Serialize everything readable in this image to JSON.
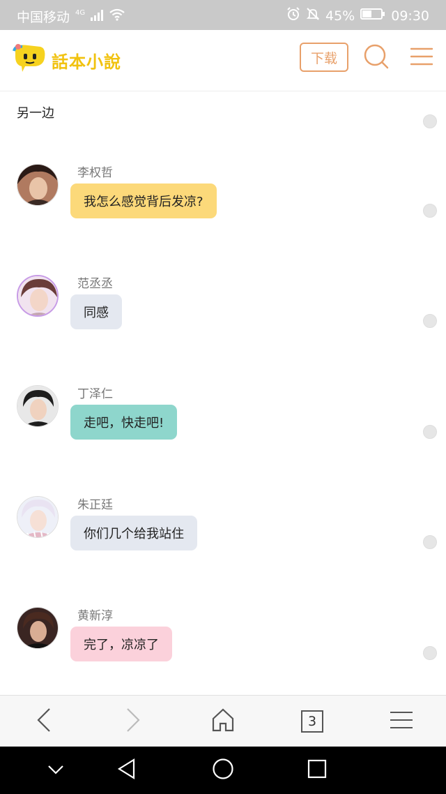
{
  "status_bar": {
    "carrier": "中国移动",
    "network": "4G",
    "battery": "45%",
    "time": "09:30"
  },
  "header": {
    "logo_text": "話本小說",
    "download_label": "下载",
    "accent_color": "#e8a06a"
  },
  "chapter": {
    "title": "另一边"
  },
  "messages": [
    {
      "name": "李权哲",
      "text": "我怎么感觉背后发凉?",
      "bubble_color": "#fcd97a"
    },
    {
      "name": "范丞丞",
      "text": "同感",
      "bubble_color": "#e4e8f0"
    },
    {
      "name": "丁泽仁",
      "text": "走吧，快走吧!",
      "bubble_color": "#8ed6cc"
    },
    {
      "name": "朱正廷",
      "text": "你们几个给我站住",
      "bubble_color": "#e4e8f0"
    },
    {
      "name": "黄新淳",
      "text": "完了，凉凉了",
      "bubble_color": "#fbd1db"
    }
  ],
  "bottom_nav": {
    "tab_count": "3"
  },
  "icons": [
    "signal-icon",
    "wifi-icon",
    "alarm-icon",
    "mute-icon",
    "battery-icon",
    "search-icon",
    "menu-icon",
    "back-icon",
    "forward-icon",
    "home-icon",
    "tabs-icon",
    "hamburger-icon",
    "collapse-icon",
    "system-back-icon",
    "system-home-icon",
    "system-recents-icon"
  ]
}
